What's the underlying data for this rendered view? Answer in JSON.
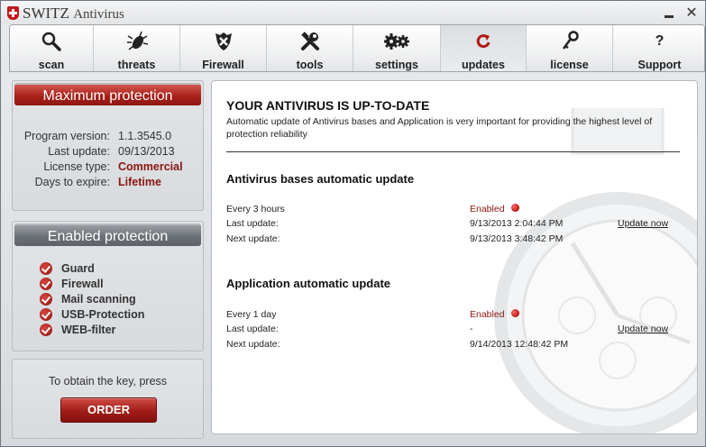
{
  "window": {
    "title_main": "SWITZ",
    "title_sub": "Antivirus"
  },
  "toolbar": {
    "tabs": [
      {
        "label": "scan",
        "icon": "magnifier-icon"
      },
      {
        "label": "threats",
        "icon": "bug-icon"
      },
      {
        "label": "Firewall",
        "icon": "shield-icon"
      },
      {
        "label": "tools",
        "icon": "tools-icon"
      },
      {
        "label": "settings",
        "icon": "gears-icon"
      },
      {
        "label": "updates",
        "icon": "refresh-icon",
        "active": true
      },
      {
        "label": "license",
        "icon": "key-icon"
      },
      {
        "label": "Support",
        "icon": "question-icon"
      }
    ]
  },
  "status_panel": {
    "banner": "Maximum protection",
    "rows": [
      {
        "key": "Program version:",
        "value": "1.1.3545.0"
      },
      {
        "key": "Last update:",
        "value": "09/13/2013"
      },
      {
        "key": "License type:",
        "value": "Commercial"
      },
      {
        "key": "Days to expire:",
        "value": "Lifetime"
      }
    ]
  },
  "protection_panel": {
    "banner": "Enabled protection",
    "items": [
      "Guard",
      "Firewall",
      "Mail scanning",
      "USB-Protection",
      "WEB-filter"
    ]
  },
  "order_panel": {
    "text": "To obtain the key, press",
    "button": "ORDER"
  },
  "main": {
    "heading": "YOUR ANTIVIRUS IS UP-TO-DATE",
    "description": "Automatic update of Antivirus bases and Application is very important for providing the highest level of protection reliability",
    "bases": {
      "title": "Antivirus bases automatic update",
      "schedule": "Every 3 hours",
      "status": "Enabled",
      "last_label": "Last update:",
      "last_value": "9/13/2013 2:04:44 PM",
      "next_label": "Next update:",
      "next_value": "9/13/2013 3:48:42 PM",
      "update_now": "Update now"
    },
    "app": {
      "title": "Application automatic update",
      "schedule": "Every 1 day",
      "status": "Enabled",
      "last_label": "Last update:",
      "last_value": "-",
      "next_label": "Next update:",
      "next_value": "9/14/2013 12:48:42 PM",
      "update_now": "Update now"
    }
  },
  "colors": {
    "accent_red": "#a8201a",
    "banner_grey": "#6c7177"
  }
}
